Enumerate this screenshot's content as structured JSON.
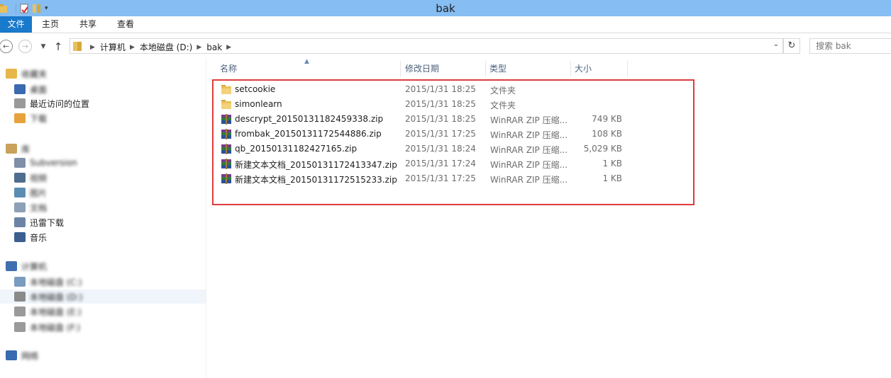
{
  "window": {
    "title": "bak"
  },
  "ribbon": {
    "file": "文件",
    "home": "主页",
    "share": "共享",
    "view": "查看"
  },
  "address": {
    "crumbs": [
      "计算机",
      "本地磁盘 (D:)",
      "bak"
    ],
    "search_placeholder": "搜索 bak"
  },
  "navpane": {
    "items": [
      {
        "label": "收藏夹",
        "icon": "star-icon",
        "color": "#e6b84a"
      },
      {
        "label": "桌面",
        "icon": "desktop-icon",
        "color": "#3a6ab0"
      },
      {
        "label": "最近访问的位置",
        "icon": "recent-places-icon",
        "color": "#9a9a9a"
      },
      {
        "label": "下载",
        "icon": "downloads-icon",
        "color": "#e6a23c"
      },
      {
        "label": "库",
        "icon": "libraries-icon",
        "color": "#c8a25a"
      },
      {
        "label": "Subversion",
        "icon": "library-icon",
        "color": "#7f8fa8"
      },
      {
        "label": "视频",
        "icon": "videos-icon",
        "color": "#4f6d8f"
      },
      {
        "label": "图片",
        "icon": "pictures-icon",
        "color": "#5b8db3"
      },
      {
        "label": "文档",
        "icon": "documents-icon",
        "color": "#8ea0b8"
      },
      {
        "label": "迅雷下载",
        "icon": "library-icon",
        "color": "#6c83a6"
      },
      {
        "label": "音乐",
        "icon": "music-icon",
        "color": "#3c5f8f"
      },
      {
        "label": "计算机",
        "icon": "computer-icon",
        "color": "#3f6fb0"
      },
      {
        "label": "本地磁盘 (C:)",
        "icon": "drive-icon",
        "color": "#7b9bc0"
      },
      {
        "label": "本地磁盘 (D:)",
        "icon": "drive-icon",
        "color": "#8a8a8a"
      },
      {
        "label": "本地磁盘 (E:)",
        "icon": "drive-icon",
        "color": "#9a9a9a"
      },
      {
        "label": "本地磁盘 (F:)",
        "icon": "drive-icon",
        "color": "#9a9a9a"
      },
      {
        "label": "网络",
        "icon": "network-icon",
        "color": "#3a6ab0"
      }
    ]
  },
  "columns": {
    "name": "名称",
    "date": "修改日期",
    "type": "类型",
    "size": "大小"
  },
  "files": [
    {
      "name": "setcookie",
      "date": "2015/1/31 18:25",
      "type": "文件夹",
      "size": "",
      "kind": "folder"
    },
    {
      "name": "simonlearn",
      "date": "2015/1/31 18:25",
      "type": "文件夹",
      "size": "",
      "kind": "folder"
    },
    {
      "name": "descrypt_20150131182459338.zip",
      "date": "2015/1/31 18:25",
      "type": "WinRAR ZIP 压缩...",
      "size": "749 KB",
      "kind": "zip"
    },
    {
      "name": "frombak_20150131172544886.zip",
      "date": "2015/1/31 17:25",
      "type": "WinRAR ZIP 压缩...",
      "size": "108 KB",
      "kind": "zip"
    },
    {
      "name": "qb_20150131182427165.zip",
      "date": "2015/1/31 18:24",
      "type": "WinRAR ZIP 压缩...",
      "size": "5,029 KB",
      "kind": "zip"
    },
    {
      "name": "新建文本文档_20150131172413347.zip",
      "date": "2015/1/31 17:24",
      "type": "WinRAR ZIP 压缩...",
      "size": "1 KB",
      "kind": "zip"
    },
    {
      "name": "新建文本文档_20150131172515233.zip",
      "date": "2015/1/31 17:25",
      "type": "WinRAR ZIP 压缩...",
      "size": "1 KB",
      "kind": "zip"
    }
  ],
  "colors": {
    "titlebar": "#86bdf2",
    "file_tab": "#1979ca",
    "highlight": "#e03c3c"
  }
}
